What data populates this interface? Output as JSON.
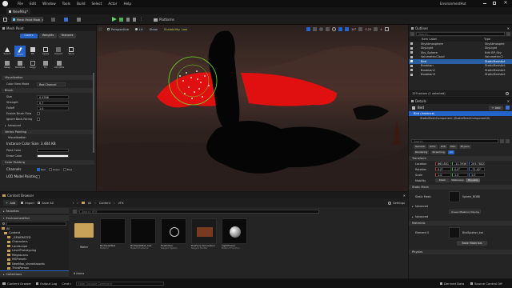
{
  "menu": [
    "File",
    "Edit",
    "Window",
    "Tools",
    "Build",
    "Select",
    "Actor",
    "Help"
  ],
  "window_title": "EnvironmentHut",
  "level_tab": "NewMap*",
  "mode_button": "Mesh Paint Mode",
  "platforms": "Platforms",
  "mesh_paint": {
    "panel_title": "Mesh Paint",
    "tabs": [
      "Colors",
      "Weights",
      "Textures"
    ],
    "tools": [
      "Select",
      "Paint",
      "Fill",
      "Apply",
      "Import",
      "Save"
    ],
    "tools2": [
      "Swap",
      "Remove",
      "Copy",
      "Fix",
      "All LODs"
    ],
    "sections": {
      "visualization": "Visualization",
      "brush": "Brush",
      "vertex_painting": "Vertex Painting",
      "visualization2": "Visualization",
      "color_painting": "Color Painting"
    },
    "view_mode_label": "Color View Mode",
    "view_mode_value": "Red Channel",
    "size_label": "Size",
    "size_value": "0.9766",
    "strength_label": "Strength",
    "strength_value": "0.7",
    "falloff_label": "Falloff",
    "falloff_value": "1.0",
    "enable_flow_label": "Enable Brush Flow",
    "ignore_backface_label": "Ignore Back-Facing",
    "advanced": "Advanced",
    "instance_color_size": "Instance Color Size: 3.484 KB",
    "paint_color_label": "Paint Color",
    "erase_color_label": "Erase Color",
    "channels_label": "Channels",
    "channels": [
      "Red",
      "Green",
      "Blue"
    ],
    "lod_label": "LOD Model Painting"
  },
  "viewport": {
    "perspective": "Perspective",
    "lit": "Lit",
    "show": "Show",
    "scalability": "Scalability: Low",
    "snap_angle": "10°",
    "snap_scale": "0.25",
    "camera_speed": "4"
  },
  "outliner": {
    "title": "Outliner",
    "search_placeholder": "Search...",
    "col_label": "Item Label",
    "col_type": "Type",
    "rows": [
      {
        "label": "SkyAtmosphere",
        "type": "SkyAtmosphe"
      },
      {
        "label": "SkyLight",
        "type": "SkyLight"
      },
      {
        "label": "Sky_Sphere",
        "type": "Edit BP_Sky"
      },
      {
        "label": "VolumetricCloud",
        "type": "VolumetricCl"
      },
      {
        "label": "Bird",
        "type": "StaticMeshAct"
      },
      {
        "label": "Boobkan",
        "type": "StaticMeshAct"
      },
      {
        "label": "Boobkan2",
        "type": "StaticMeshAct"
      },
      {
        "label": "Boobkan3",
        "type": "StaticMeshAct"
      }
    ],
    "status": "129 actors (1 selected)"
  },
  "details": {
    "title": "Details",
    "actor_name": "Bird",
    "add_label": "+ Add",
    "instance_label": "Bird (Instance)",
    "component_label": "StaticMeshComponent (StaticMeshComponent0)",
    "search_placeholder": "Search",
    "filter_tabs": [
      "General",
      "Actor",
      "LOD",
      "Misc",
      "Physics"
    ],
    "filter_tabs2": [
      "Rendering",
      "Streaming",
      "All"
    ],
    "transform": "Transform",
    "location_label": "Location",
    "location": [
      "860.801",
      "-11.3936",
      "205.7802"
    ],
    "rotation_label": "Rotation",
    "rotation": [
      "0.0°",
      "0.0°",
      "-71.42°"
    ],
    "scale_label": "Scale",
    "scale": [
      "1.0",
      "1.0",
      "1.0"
    ],
    "mobility_label": "Mobility",
    "mobility": [
      "Static",
      "Stationary",
      "Movable"
    ],
    "static_mesh_section": "Static Mesh",
    "static_mesh_label": "Static Mesh",
    "static_mesh_value": "Sphere_BOBB",
    "advanced": "Advanced",
    "overlay_value": "Ocean Masking Volume",
    "materials_section": "Materials",
    "element_label": "Element 0",
    "material_value": "BirdSplatter_Inst",
    "bake_materials": "Bake Materials",
    "physics": "Physics"
  },
  "content_browser": {
    "title": "Content Browser",
    "add_label": "Add",
    "import_label": "Import",
    "save_all_label": "Save All",
    "breadcrumb": [
      "All",
      "Content",
      "VFX"
    ],
    "settings": "Settings",
    "favorites": "Favorites",
    "project": "EnvironmentHut",
    "search_placeholder": "Search VFX",
    "tree": [
      "All",
      "Content",
      "_GENERATED",
      "Characters",
      "Landscape",
      "LevelPrototyping",
      "Megascans",
      "MSPresets",
      "NewMap_sharedassets",
      "ThirdPerson",
      "VFX"
    ],
    "collections": "Collections",
    "items": [
      {
        "name": "Water",
        "type": ""
      },
      {
        "name": "BirdSplatMat",
        "type": "Material"
      },
      {
        "name": "BirdSplatMat_Inst",
        "type": "Material Instance"
      },
      {
        "name": "FireEmber",
        "type": "Niagara System"
      },
      {
        "name": "FireFlyre Simulation",
        "type": "Niagara Emitter"
      },
      {
        "name": "LightFlicker",
        "type": "Material Function"
      }
    ],
    "status": "6 items"
  },
  "statusbar": {
    "content_drawer": "Content Drawer",
    "output_log": "Output Log",
    "cmd": "Cmd",
    "cmd_placeholder": "Enter Console Command",
    "derived_data": "Derived Data",
    "source_control": "Source Control Off"
  }
}
